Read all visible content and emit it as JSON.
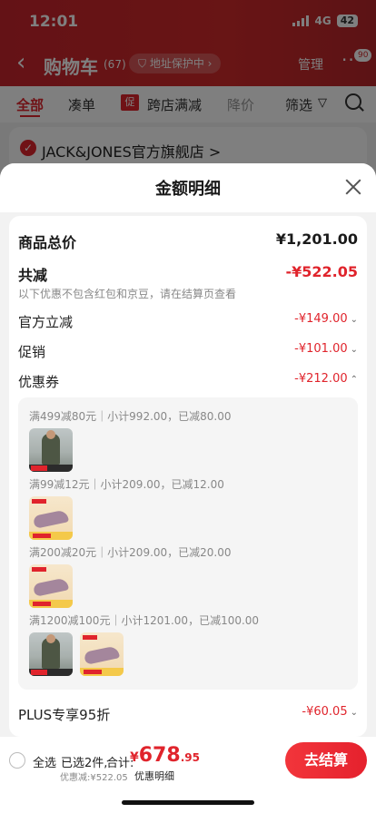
{
  "status": {
    "time": "12:01",
    "network": "4G",
    "battery": "42"
  },
  "nav": {
    "title": "购物车",
    "count": "(67)",
    "address_pill": "地址保护中",
    "manage": "管理",
    "more_badge": "90"
  },
  "filters": {
    "all": "全部",
    "combine": "凑单",
    "cross_store_tag": "促",
    "cross_store": "跨店满减",
    "price": "降价",
    "sift": "筛选"
  },
  "store": {
    "name": "JACK&JONES官方旗舰店 >"
  },
  "sheet": {
    "title": "金额明细",
    "total_label": "商品总价",
    "total_value": "¥1,201.00",
    "reduce_label": "共减",
    "reduce_value": "-¥522.05",
    "note": "以下优惠不包含红包和京豆，请在结算页查看",
    "items": [
      {
        "label": "官方立减",
        "value": "-¥149.00",
        "chevron": "⌄"
      },
      {
        "label": "促销",
        "value": "-¥101.00",
        "chevron": "⌄"
      },
      {
        "label": "优惠券",
        "value": "-¥212.00",
        "chevron": "⌃"
      }
    ],
    "coupons": [
      {
        "rule": "满499减80元｜小计992.00，已减80.00",
        "thumbs": [
          "jacket"
        ]
      },
      {
        "rule": "满99减12元｜小计209.00，已减12.00",
        "thumbs": [
          "shoe"
        ]
      },
      {
        "rule": "满200减20元｜小计209.00，已减20.00",
        "thumbs": [
          "shoe"
        ]
      },
      {
        "rule": "满1200减100元｜小计1201.00，已减100.00",
        "thumbs": [
          "jacket",
          "shoe"
        ]
      }
    ],
    "plus_label": "PLUS专享95折",
    "plus_value": "-¥60.05",
    "plus_chevron": "⌄"
  },
  "bottom": {
    "select_all": "全选",
    "selected": "已选2件,",
    "total_label": "合计:",
    "currency": "¥",
    "amount_int": "678",
    "amount_dec": ".95",
    "discount": "优惠减:¥522.05",
    "detail": "优惠明细",
    "checkout": "去结算"
  },
  "colors": {
    "accent": "#e0242c",
    "header": "#d12a2a"
  }
}
